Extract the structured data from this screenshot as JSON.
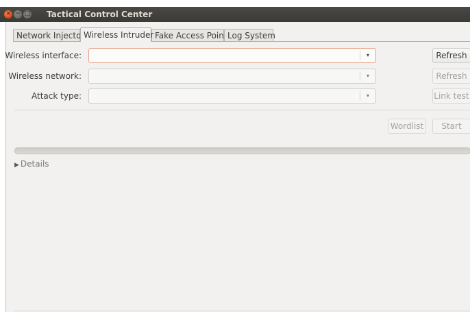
{
  "window": {
    "title": "Tactical Control Center",
    "buttons": {
      "close": "×",
      "minimize": "−",
      "maximize": "□"
    }
  },
  "tabs": [
    {
      "label": "Network Injector",
      "active": false
    },
    {
      "label": "Wireless Intruder",
      "active": true
    },
    {
      "label": "Fake Access Point",
      "active": false
    },
    {
      "label": "Log System",
      "active": false
    }
  ],
  "form": {
    "interface_label": "Wireless interface:",
    "network_label": "Wireless network:",
    "attack_label": "Attack type:",
    "interface_value": "",
    "network_value": "",
    "attack_value": "",
    "dropdown_glyph": "▾"
  },
  "buttons": {
    "refresh_interface": "Refresh",
    "refresh_network": "Refresh",
    "link_test": "Link test",
    "wordlist": "Wordlist",
    "start": "Start"
  },
  "progress": {
    "value": 0
  },
  "details": {
    "label": "Details",
    "expander_glyph": "▶"
  },
  "colors": {
    "titlebar": "#3c3b37",
    "close_button": "#e2531f",
    "focus_border": "#e7a28a",
    "window_bg": "#f2f1f0"
  }
}
